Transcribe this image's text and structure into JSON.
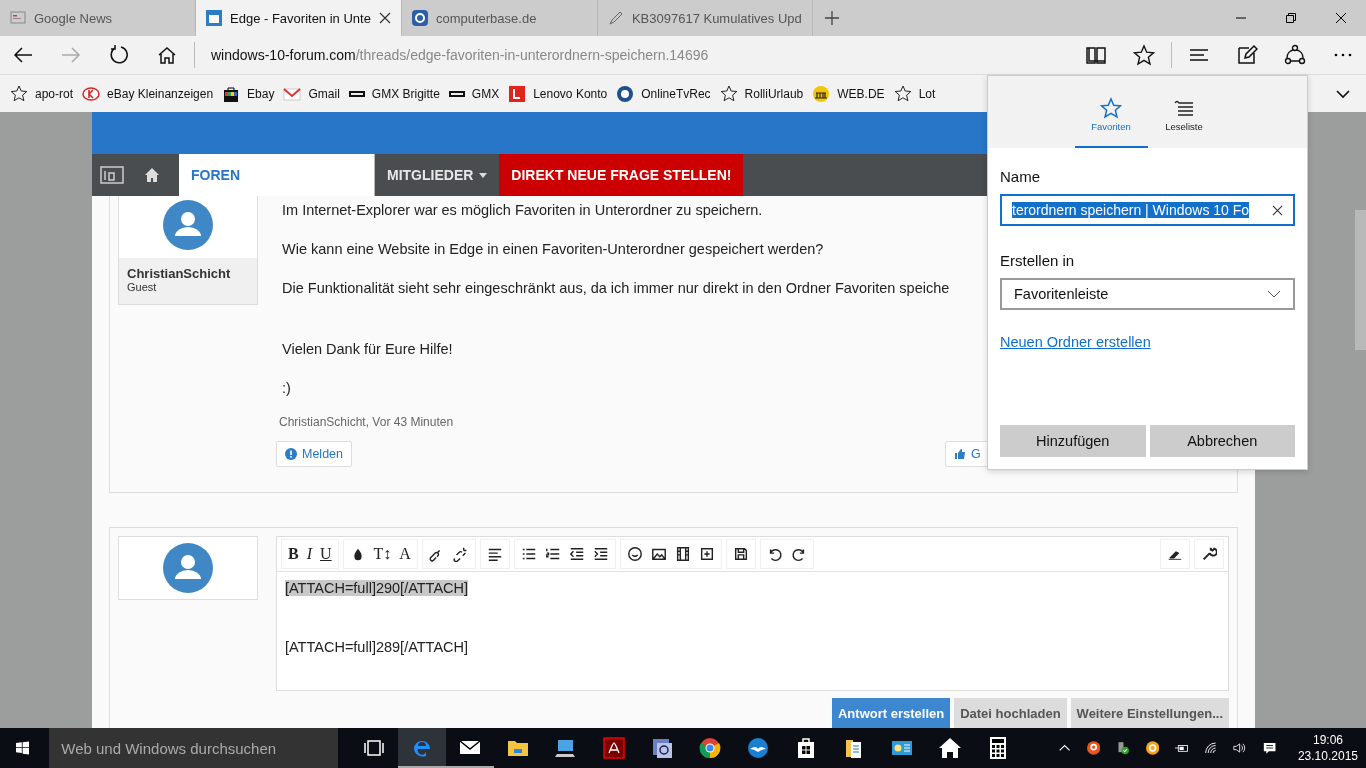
{
  "tabs": [
    {
      "title": "Google News",
      "kind": "news",
      "selected": false
    },
    {
      "title": "Edge - Favoriten in Unte",
      "kind": "forum",
      "selected": true
    },
    {
      "title": "computerbase.de",
      "kind": "cb",
      "selected": false
    },
    {
      "title": "KB3097617 Kumulatives Upd",
      "kind": "pen",
      "selected": false
    }
  ],
  "address_bar": {
    "domain": "windows-10-forum.com",
    "path": "/threads/edge-favoriten-in-unterordnern-speichern.14696"
  },
  "favorites_bar": [
    {
      "label": "apo-rot",
      "kind": "star"
    },
    {
      "label": "eBay Kleinanzeigen",
      "kind": "k"
    },
    {
      "label": "Ebay",
      "kind": "bag"
    },
    {
      "label": "Gmail",
      "kind": "mail"
    },
    {
      "label": "GMX Brigitte",
      "kind": "gmx"
    },
    {
      "label": "GMX",
      "kind": "gmx"
    },
    {
      "label": "Lenovo Konto",
      "kind": "lenovo"
    },
    {
      "label": "OnlineTvRec",
      "kind": "tv"
    },
    {
      "label": "RolliUrlaub",
      "kind": "star"
    },
    {
      "label": "WEB.DE",
      "kind": "webde"
    },
    {
      "label": "Lot",
      "kind": "star"
    }
  ],
  "site_nav": [
    {
      "label": "FOREN",
      "kind": "tab",
      "selected": true
    },
    {
      "label": "MITGLIEDER",
      "kind": "menu",
      "selected": false
    },
    {
      "label": "DIREKT NEUE FRAGE STELLEN!",
      "kind": "cta",
      "selected": false
    }
  ],
  "post": {
    "author": "ChristianSchicht",
    "role": "Guest",
    "paragraphs": [
      "Im Internet-Explorer war es möglich Favoriten in Unterordner zu speichern.",
      "Wie kann eine Website in Edge in einen Favoriten-Unterordner gespeichert werden?",
      "Die Funktionalität sieht sehr eingeschränkt aus, da ich immer nur direkt in den Ordner Favoriten speiche",
      "Vielen Dank für Eure Hilfe!",
      ":)"
    ],
    "meta": "ChristianSchicht, Vor 43 Minuten",
    "report_button": "Melden",
    "like_button": "G"
  },
  "editor": {
    "format_buttons": [
      "B",
      "I",
      "U"
    ],
    "font_buttons": [
      "T↕",
      "A"
    ],
    "lines": [
      {
        "text": "[ATTACH=full]290[/ATTACH]",
        "selected": true
      },
      {
        "text": "[ATTACH=full]289[/ATTACH]",
        "selected": false
      }
    ],
    "buttons": [
      {
        "label": "Antwort erstellen",
        "kind": "primary"
      },
      {
        "label": "Datei hochladen",
        "kind": "secondary"
      },
      {
        "label": "Weitere Einstellungen...",
        "kind": "secondary"
      }
    ]
  },
  "flyout": {
    "tabs": [
      {
        "label": "Favoriten",
        "kind": "star",
        "selected": true
      },
      {
        "label": "Leseliste",
        "kind": "list",
        "selected": false
      }
    ],
    "name_label": "Name",
    "name_value": "terordnern speichern | Windows 10 Fo",
    "folder_label": "Erstellen in",
    "folder_value": "Favoritenleiste",
    "new_folder_link": "Neuen Ordner erstellen",
    "buttons": [
      "Hinzufügen",
      "Abbrechen"
    ]
  },
  "taskbar": {
    "search_placeholder": "Web und Windows durchsuchen",
    "time": "19:06",
    "date": "23.10.2015"
  }
}
